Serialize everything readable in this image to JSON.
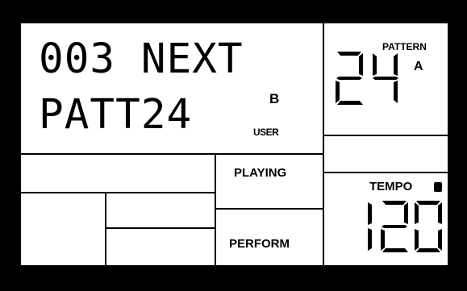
{
  "display": {
    "line1": "003 NEXT",
    "line2": "PATT24",
    "bank_letter": "B",
    "bank_type": "USER"
  },
  "pattern": {
    "label": "PATTERN",
    "number": "24",
    "bank": "A"
  },
  "status": {
    "playing": "PLAYING",
    "perform": "PERFORM"
  },
  "tempo": {
    "label": "TEMPO",
    "value": "120",
    "indicator": "filled-square"
  }
}
